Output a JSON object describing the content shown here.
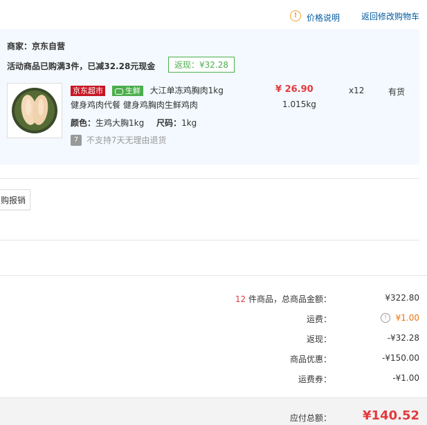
{
  "header": {
    "price_note": "价格说明",
    "return_cart": "返回修改购物车"
  },
  "shop": {
    "merchant_label": "商家：",
    "merchant_name": "京东自营",
    "promo_text": "活动商品已购满3件，已减32.28元现金",
    "rebate_tag": "返现：¥32.28"
  },
  "product": {
    "tag_jd": "京东超市",
    "tag_fresh": "生鲜",
    "title_line1": "大江单冻鸡胸肉1kg",
    "title_line2": "健身鸡肉代餐 健身鸡胸肉生鲜鸡肉",
    "price": "¥ 26.90",
    "weight": "1.015kg",
    "qty": "x12",
    "stock": "有货",
    "color_label": "颜色：",
    "color_value": "生鸡大胸1kg",
    "size_label": "尺码：",
    "size_value": "1kg",
    "return_icon": "7",
    "return_note": "不支持7天无理由退货"
  },
  "invoice_button": "购报销",
  "summary": {
    "count": "12",
    "count_label": "件商品，总商品金额：",
    "goods_total": "¥322.80",
    "shipping_label": "运费：",
    "shipping_value": "¥1.00",
    "rebate_label": "返现：",
    "rebate_value": "-¥32.28",
    "discount_label": "商品优惠：",
    "discount_value": "-¥150.00",
    "shipcoupon_label": "运费券：",
    "shipcoupon_value": "-¥1.00"
  },
  "footer": {
    "total_label": "应付总额：",
    "total_value": "¥140.52"
  },
  "colors": {
    "accent_red": "#e4393c",
    "link_blue": "#005aa0",
    "panel_bg": "#f3f9fe",
    "green": "#4cae4c",
    "orange": "#f0a030"
  }
}
